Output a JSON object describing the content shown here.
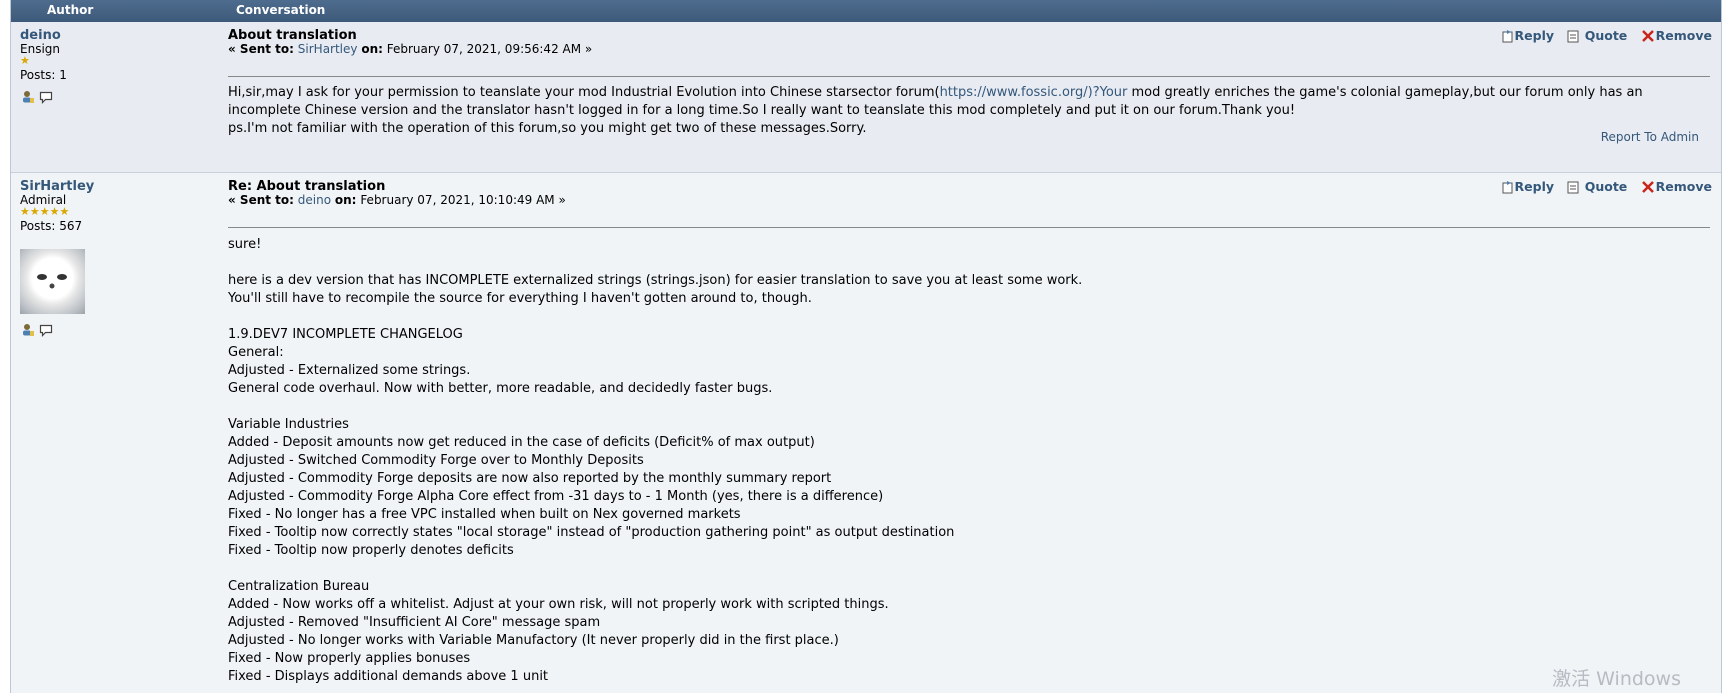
{
  "header": {
    "author": "Author",
    "conversation": "Conversation"
  },
  "messages": [
    {
      "author": "deino",
      "rank": "Ensign",
      "stars": "★",
      "posts": "Posts: 1",
      "subject": "About translation",
      "sent_prefix": "« Sent to:",
      "sent_to": "SirHartley",
      "on": "on:",
      "date": "February 07, 2021, 09:56:42 AM »",
      "actions": {
        "reply": "Reply",
        "quote": "Quote",
        "remove": "Remove"
      },
      "body": {
        "line1_before_link": "Hi,sir,may I ask for your permission to teanslate your mod Industrial Evolution into Chinese starsector forum(",
        "link": "https://www.fossic.org/)?Your",
        "line1_after_link": " mod greatly enriches the game's colonial gameplay,but our forum only has an",
        "line2": "incomplete Chinese version and the translator hasn't logged in for a long time.So I really want to teanslate this mod completely and put it on our forum.Thank you!",
        "line3": "ps.I'm not familiar with the operation of this forum,so you might get two of these messages.Sorry."
      },
      "report": "Report To Admin"
    },
    {
      "author": "SirHartley",
      "rank": "Admiral",
      "stars": "★★★★★",
      "posts": "Posts: 567",
      "subject": "Re: About translation",
      "sent_prefix": "« Sent to:",
      "sent_to": "deino",
      "on": "on:",
      "date": "February 07, 2021, 10:10:49 AM »",
      "actions": {
        "reply": "Reply",
        "quote": "Quote",
        "remove": "Remove"
      },
      "body_lines": [
        "sure!",
        "",
        "here is a dev version that has INCOMPLETE externalized strings (strings.json) for easier translation to save you at least some work.",
        "You'll still have to recompile the source for everything I haven't gotten around to, though.",
        "",
        "1.9.DEV7 INCOMPLETE CHANGELOG",
        "General:",
        "Adjusted - Externalized some strings.",
        "General code overhaul. Now with better, more readable, and decidedly faster bugs.",
        "",
        "Variable Industries",
        "Added - Deposit amounts now get reduced in the case of deficits (Deficit% of max output)",
        "Adjusted - Switched Commodity Forge over to Monthly Deposits",
        "Adjusted - Commodity Forge deposits are now also reported by the monthly summary report",
        "Adjusted - Commodity Forge Alpha Core effect from -31 days to - 1 Month (yes, there is a difference)",
        "Fixed - No longer has a free VPC installed when built on Nex governed markets",
        "Fixed - Tooltip now correctly states \"local storage\" instead of \"production gathering point\" as output destination",
        "Fixed - Tooltip now properly denotes deficits",
        "",
        "Centralization Bureau",
        "Added - Now works off a whitelist. Adjust at your own risk, will not properly work with scripted things.",
        "Adjusted - Removed \"Insufficient AI Core\" message spam",
        "Adjusted - No longer works with Variable Manufactory (It never properly did in the first place.)",
        "Fixed - Now properly applies bonuses",
        "Fixed - Displays additional demands above 1 unit"
      ]
    }
  ],
  "watermark": "激活 Windows"
}
